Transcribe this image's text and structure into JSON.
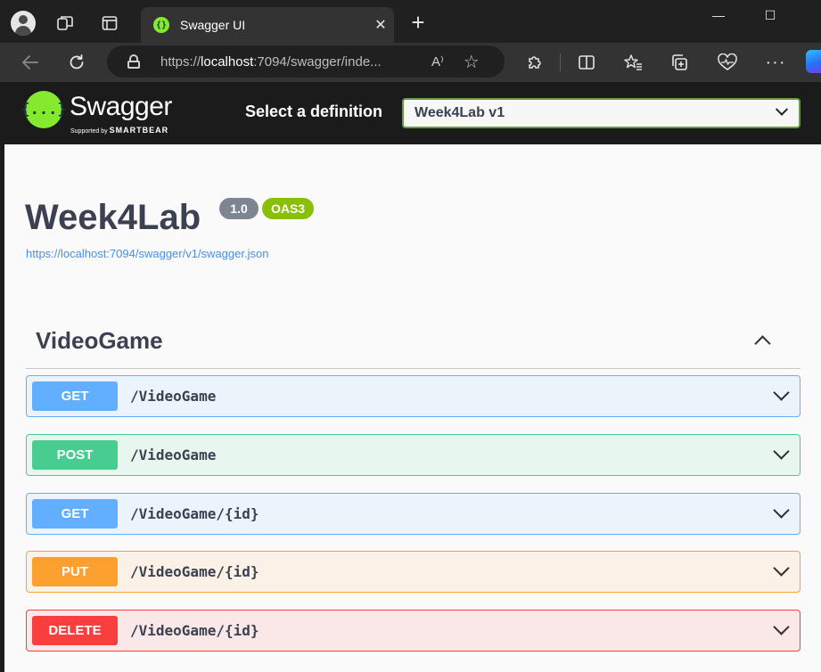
{
  "browser": {
    "tab_title": "Swagger UI",
    "tab_close": "✕",
    "new_tab": "+",
    "url_prefix": "https://",
    "url_host": "localhost",
    "url_rest": ":7094/swagger/inde...",
    "read_aloud": "A⁾",
    "window_minimize": "—",
    "window_maximize": "☐"
  },
  "swagger": {
    "logo_glyph": "{...}",
    "logo_text": "Swagger",
    "logo_supported": "Supported by",
    "logo_company": "SMARTBEAR",
    "definition_label": "Select a definition",
    "definition_value": "Week4Lab v1"
  },
  "info": {
    "title": "Week4Lab",
    "version": "1.0",
    "oas": "OAS3",
    "spec_url": "https://localhost:7094/swagger/v1/swagger.json"
  },
  "tag": {
    "name": "VideoGame"
  },
  "operations": [
    {
      "method": "GET",
      "path": "/VideoGame"
    },
    {
      "method": "POST",
      "path": "/VideoGame"
    },
    {
      "method": "GET",
      "path": "/VideoGame/{id}"
    },
    {
      "method": "PUT",
      "path": "/VideoGame/{id}"
    },
    {
      "method": "DELETE",
      "path": "/VideoGame/{id}"
    }
  ],
  "colors": {
    "get": "#61affe",
    "post": "#49cc90",
    "put": "#fca130",
    "delete": "#f93e3e",
    "swagger_green": "#85ea2d"
  },
  "icons": [
    "profile-icon",
    "workspaces-icon",
    "tab-actions-icon",
    "back-icon",
    "refresh-icon",
    "lock-icon",
    "favorite-star-icon",
    "extensions-icon",
    "split-screen-icon",
    "favorites-icon",
    "collections-icon",
    "browser-essentials-icon",
    "more-icon",
    "copilot-icon"
  ]
}
